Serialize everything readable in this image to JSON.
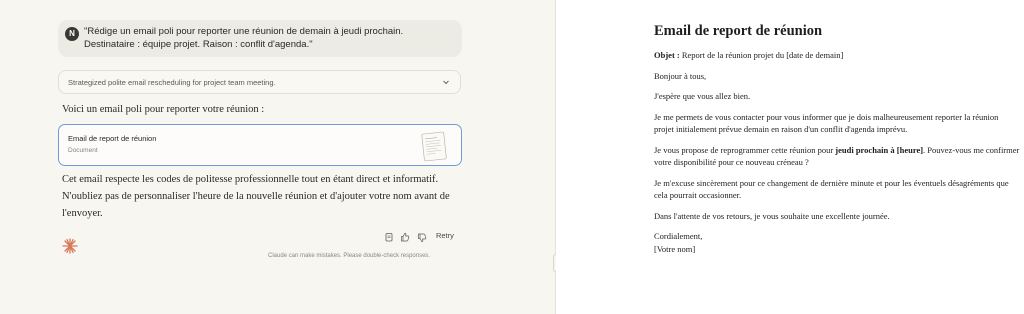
{
  "chat": {
    "user_avatar": "N",
    "user_message": "\"Rédige un email poli pour reporter une réunion de demain à jeudi prochain. Destinataire : équipe projet. Raison : conflit d'agenda.\"",
    "thought_summary": "Strategized polite email rescheduling for project team meeting.",
    "intro": "Voici un email poli pour reporter votre réunion :",
    "artifact": {
      "title": "Email de report de réunion",
      "type": "Document"
    },
    "response": "Cet email respecte les codes de politesse professionnelle tout en étant direct et informatif. N'oubliez pas de personnaliser l'heure de la nouvelle réunion et d'ajouter votre nom avant de l'envoyer.",
    "retry_label": "Retry",
    "disclaimer": "Claude can make mistakes. Please double-check responses."
  },
  "document": {
    "title": "Email de report de réunion",
    "subject_label": "Objet :",
    "subject_value": " Report de la réunion projet du [date de demain]",
    "greeting": "Bonjour à tous,",
    "p1": "J'espère que vous allez bien.",
    "p2": "Je me permets de vous contacter pour vous informer que je dois malheureusement reporter la réunion projet initialement prévue demain en raison d'un conflit d'agenda imprévu.",
    "p3_a": "Je vous propose de reprogrammer cette réunion pour ",
    "p3_bold": "jeudi prochain à [heure]",
    "p3_b": ". Pouvez-vous me confirmer votre disponibilité pour ce nouveau créneau ?",
    "p4": "Je m'excuse sincèrement pour ce changement de dernière minute et pour les éventuels désagréments que cela pourrait occasionner.",
    "p5": "Dans l'attente de vos retours, je vous souhaite une excellente journée.",
    "closing": "Cordialement,",
    "signature": "[Votre nom]"
  },
  "colors": {
    "accent_border": "#6d9dd8",
    "claude_orange": "#d97757"
  },
  "icons": [
    "chevron-down-icon",
    "document-thumbnail-icon",
    "copy-icon",
    "thumbs-up-icon",
    "thumbs-down-icon",
    "claude-spark-icon"
  ]
}
